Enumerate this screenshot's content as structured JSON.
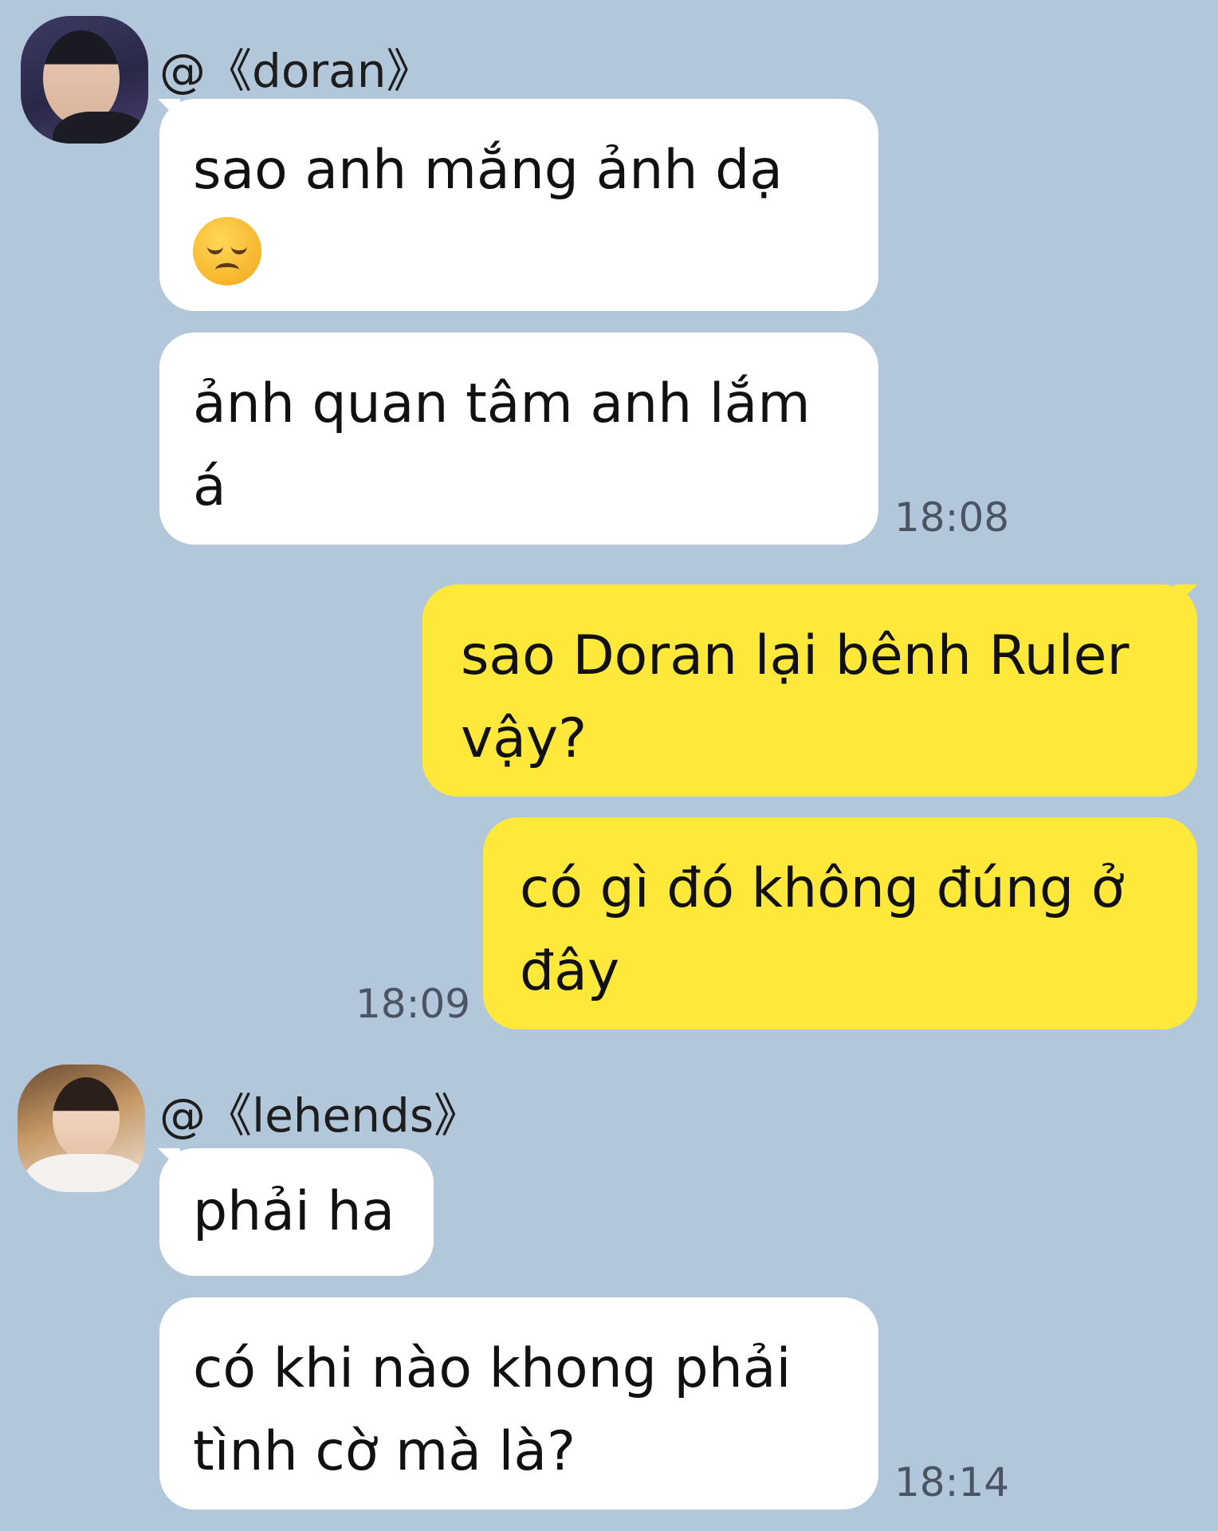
{
  "chat": {
    "sender1": {
      "name": "@《doran》",
      "avatar_icon": "profile-photo-icon"
    },
    "sender2": {
      "name": "@《lehends》",
      "avatar_icon": "profile-photo-icon"
    },
    "messages": [
      {
        "from": "doran",
        "line1": "sao anh mắng ảnh dạ",
        "emoji": "disappointed-face-icon"
      },
      {
        "from": "doran",
        "line1": "ảnh quan tâm anh lắm",
        "line2": "á",
        "time": "18:08"
      },
      {
        "from": "me",
        "line1": "sao Doran lại bênh Ruler",
        "line2": "vậy?"
      },
      {
        "from": "me",
        "line1": "có gì đó không đúng ở",
        "line2": "đây",
        "time": "18:09"
      },
      {
        "from": "lehends",
        "line1": "phải ha"
      },
      {
        "from": "lehends",
        "line1": "có khi nào khong phải",
        "line2": "tình cờ mà là?",
        "time": "18:14"
      }
    ]
  },
  "colors": {
    "background": "#b2c7da",
    "incoming_bubble": "#ffffff",
    "outgoing_bubble": "#fee83a"
  }
}
